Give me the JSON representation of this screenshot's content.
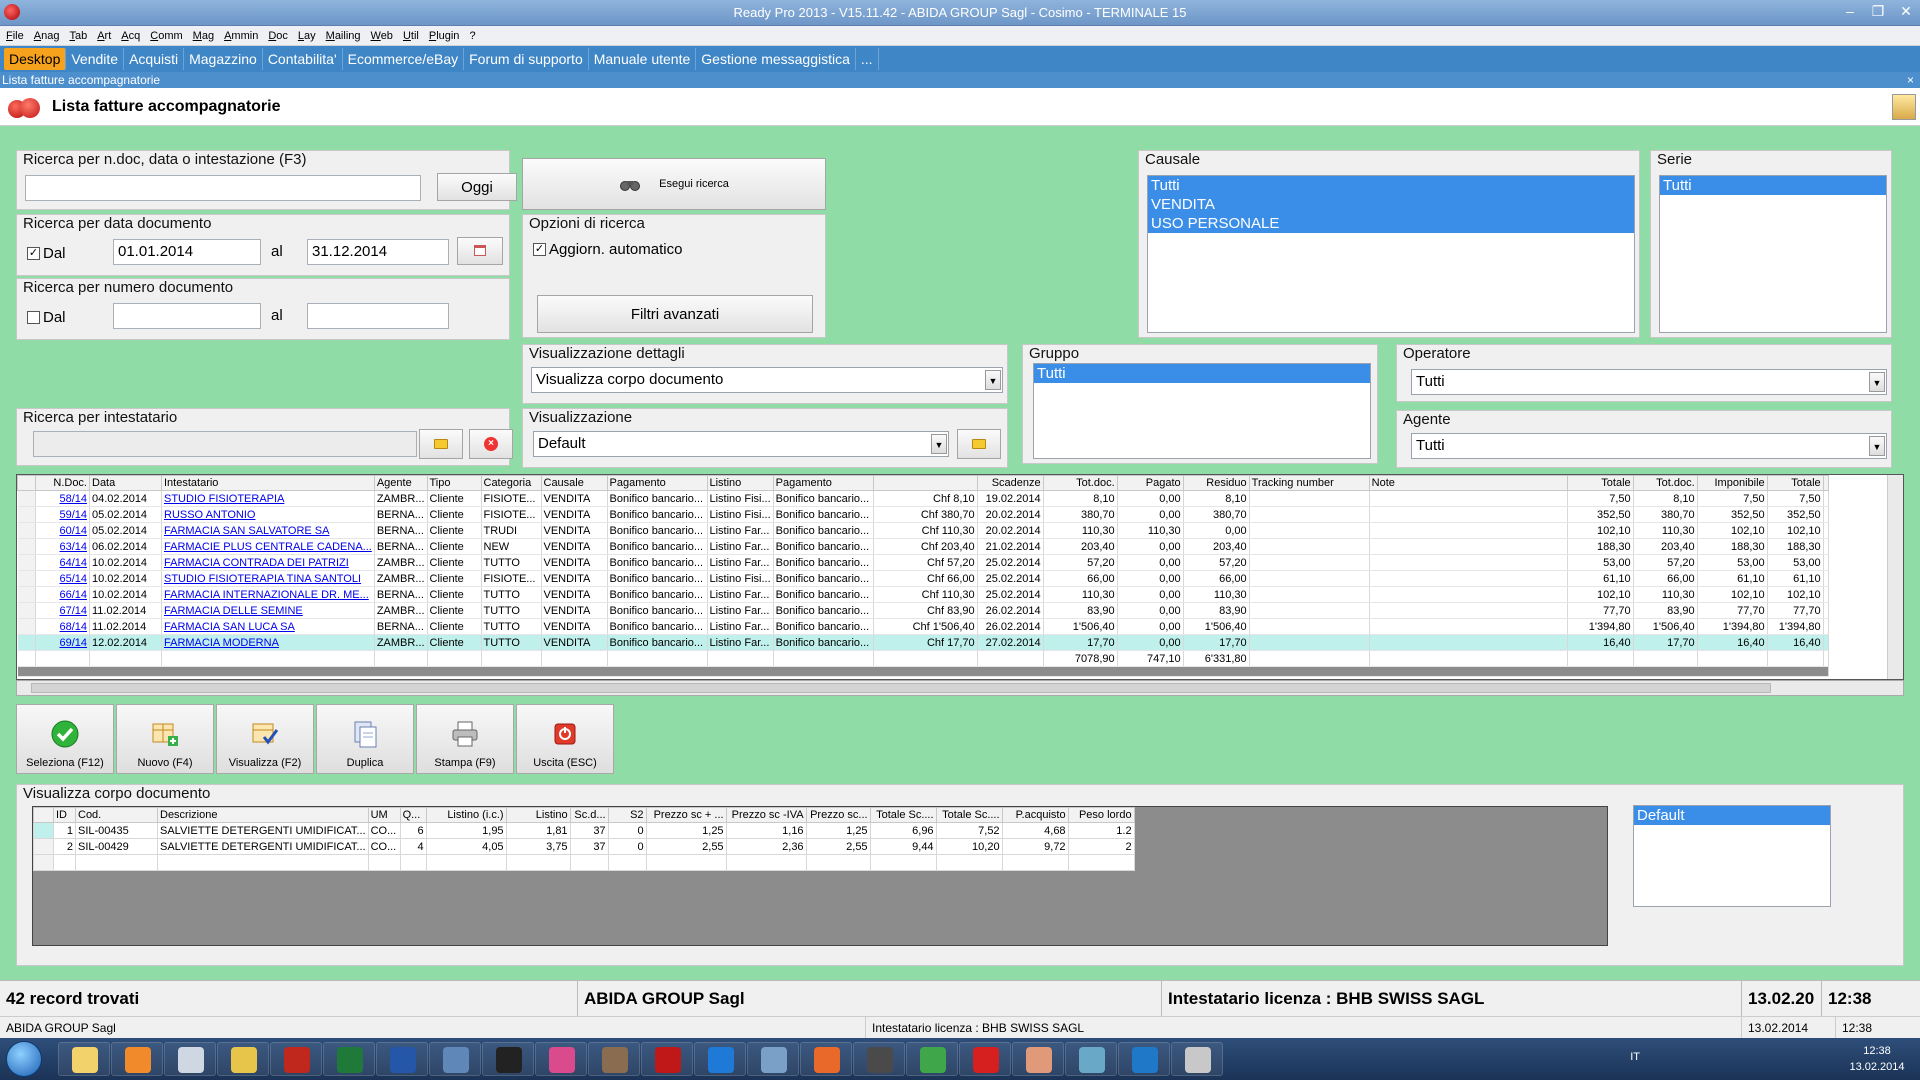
{
  "window": {
    "title": "Ready Pro 2013 - V15.11.42 - ABIDA GROUP Sagl - Cosimo - TERMINALE 15",
    "minimize": "–",
    "maximize": "❐",
    "close": "✕"
  },
  "menu": [
    "File",
    "Anag",
    "Tab",
    "Art",
    "Acq",
    "Comm",
    "Mag",
    "Ammin",
    "Doc",
    "Lay",
    "Mailing",
    "Web",
    "Util",
    "Plugin",
    "?"
  ],
  "tabs": [
    {
      "label": "Desktop",
      "active": true
    },
    {
      "label": "Vendite"
    },
    {
      "label": "Acquisti"
    },
    {
      "label": "Magazzino"
    },
    {
      "label": "Contabilita'"
    },
    {
      "label": "Ecommerce/eBay"
    },
    {
      "label": "Forum di supporto"
    },
    {
      "label": "Manuale utente"
    },
    {
      "label": "Gestione messaggistica"
    },
    {
      "label": "..."
    }
  ],
  "subwindow": {
    "title": "Lista fatture accompagnatorie",
    "close": "×"
  },
  "header": {
    "title": "Lista fatture accompagnatorie"
  },
  "search": {
    "ndoc_label": "Ricerca per n.doc, data o intestazione (F3)",
    "ndoc_value": "",
    "today_button": "Oggi",
    "execute_button": "Esegui ricerca",
    "date_label": "Ricerca per data documento",
    "date_from_check": "Dal",
    "date_from": "01.01.2014",
    "date_to_label": "al",
    "date_to": "31.12.2014",
    "num_label": "Ricerca per numero documento",
    "num_from_check": "Dal",
    "num_to_label": "al",
    "holder_label": "Ricerca per intestatario",
    "options_label": "Opzioni di ricerca",
    "auto_update": "Aggiorn. automatico",
    "advanced_filters": "Filtri avanzati",
    "details_label": "Visualizzazione dettagli",
    "details_value": "Visualizza corpo documento",
    "view_label": "Visualizzazione",
    "view_value": "Default"
  },
  "causale": {
    "label": "Causale",
    "items": [
      "Tutti",
      "VENDITA",
      "USO PERSONALE"
    ]
  },
  "serie": {
    "label": "Serie",
    "items": [
      "Tutti"
    ]
  },
  "gruppo": {
    "label": "Gruppo",
    "items": [
      "Tutti"
    ]
  },
  "operatore": {
    "label": "Operatore",
    "value": "Tutti"
  },
  "agente": {
    "label": "Agente",
    "value": "Tutti"
  },
  "grid": {
    "columns": [
      "N.Doc.",
      "Data",
      "Intestatario",
      "Agente",
      "Tipo",
      "Categoria",
      "Causale",
      "Pagamento",
      "Listino",
      "Pagamento",
      "",
      "Scadenze",
      "Tot.doc.",
      "Pagato",
      "Residuo",
      "Tracking number",
      "Note",
      "Totale",
      "Tot.doc.",
      "Imponibile",
      "Totale"
    ],
    "rows": [
      [
        "58/14",
        "04.02.2014",
        "STUDIO FISIOTERAPIA",
        "ZAMBR...",
        "Cliente",
        "FISIOTE...",
        "VENDITA",
        "Bonifico bancario...",
        "Listino Fisi...",
        "Bonifico bancario...",
        "Chf 8,10",
        "19.02.2014",
        "8,10",
        "0,00",
        "8,10",
        "",
        "",
        "7,50",
        "8,10",
        "7,50",
        "7,50"
      ],
      [
        "59/14",
        "05.02.2014",
        "RUSSO ANTONIO",
        "BERNA...",
        "Cliente",
        "FISIOTE...",
        "VENDITA",
        "Bonifico bancario...",
        "Listino Fisi...",
        "Bonifico bancario...",
        "Chf 380,70",
        "20.02.2014",
        "380,70",
        "0,00",
        "380,70",
        "",
        "",
        "352,50",
        "380,70",
        "352,50",
        "352,50"
      ],
      [
        "60/14",
        "05.02.2014",
        "FARMACIA SAN SALVATORE SA",
        "BERNA...",
        "Cliente",
        "TRUDI",
        "VENDITA",
        "Bonifico bancario...",
        "Listino Far...",
        "Bonifico bancario...",
        "Chf 110,30",
        "20.02.2014",
        "110,30",
        "110,30",
        "0,00",
        "",
        "",
        "102,10",
        "110,30",
        "102,10",
        "102,10"
      ],
      [
        "63/14",
        "06.02.2014",
        "FARMACIE PLUS CENTRALE CADENA...",
        "BERNA...",
        "Cliente",
        "NEW",
        "VENDITA",
        "Bonifico bancario...",
        "Listino Far...",
        "Bonifico bancario...",
        "Chf 203,40",
        "21.02.2014",
        "203,40",
        "0,00",
        "203,40",
        "",
        "",
        "188,30",
        "203,40",
        "188,30",
        "188,30"
      ],
      [
        "64/14",
        "10.02.2014",
        "FARMACIA CONTRADA DEI PATRIZI",
        "ZAMBR...",
        "Cliente",
        "TUTTO",
        "VENDITA",
        "Bonifico bancario...",
        "Listino Far...",
        "Bonifico bancario...",
        "Chf 57,20",
        "25.02.2014",
        "57,20",
        "0,00",
        "57,20",
        "",
        "",
        "53,00",
        "57,20",
        "53,00",
        "53,00"
      ],
      [
        "65/14",
        "10.02.2014",
        "STUDIO FISIOTERAPIA TINA SANTOLI",
        "ZAMBR...",
        "Cliente",
        "FISIOTE...",
        "VENDITA",
        "Bonifico bancario...",
        "Listino Fisi...",
        "Bonifico bancario...",
        "Chf 66,00",
        "25.02.2014",
        "66,00",
        "0,00",
        "66,00",
        "",
        "",
        "61,10",
        "66,00",
        "61,10",
        "61,10"
      ],
      [
        "66/14",
        "10.02.2014",
        "FARMACIA INTERNAZIONALE DR. ME...",
        "BERNA...",
        "Cliente",
        "TUTTO",
        "VENDITA",
        "Bonifico bancario...",
        "Listino Far...",
        "Bonifico bancario...",
        "Chf 110,30",
        "25.02.2014",
        "110,30",
        "0,00",
        "110,30",
        "",
        "",
        "102,10",
        "110,30",
        "102,10",
        "102,10"
      ],
      [
        "67/14",
        "11.02.2014",
        "FARMACIA DELLE SEMINE",
        "ZAMBR...",
        "Cliente",
        "TUTTO",
        "VENDITA",
        "Bonifico bancario...",
        "Listino Far...",
        "Bonifico bancario...",
        "Chf 83,90",
        "26.02.2014",
        "83,90",
        "0,00",
        "83,90",
        "",
        "",
        "77,70",
        "83,90",
        "77,70",
        "77,70"
      ],
      [
        "68/14",
        "11.02.2014",
        "FARMACIA SAN LUCA SA",
        "BERNA...",
        "Cliente",
        "TUTTO",
        "VENDITA",
        "Bonifico bancario...",
        "Listino Far...",
        "Bonifico bancario...",
        "Chf 1'506,40",
        "26.02.2014",
        "1'506,40",
        "0,00",
        "1'506,40",
        "",
        "",
        "1'394,80",
        "1'506,40",
        "1'394,80",
        "1'394,80"
      ],
      [
        "69/14",
        "12.02.2014",
        "FARMACIA MODERNA",
        "ZAMBR...",
        "Cliente",
        "TUTTO",
        "VENDITA",
        "Bonifico bancario...",
        "Listino Far...",
        "Bonifico bancario...",
        "Chf 17,70",
        "27.02.2014",
        "17,70",
        "0,00",
        "17,70",
        "",
        "",
        "16,40",
        "17,70",
        "16,40",
        "16,40"
      ]
    ],
    "totals": {
      "totdoc": "7078,90",
      "pagato": "747,10",
      "residuo": "6'331,80"
    }
  },
  "toolbar": [
    {
      "label": "Seleziona (F12)",
      "icon": "check-icon"
    },
    {
      "label": "Nuovo (F4)",
      "icon": "new-doc-icon"
    },
    {
      "label": "Visualizza (F2)",
      "icon": "view-icon"
    },
    {
      "label": "Duplica",
      "icon": "duplicate-icon"
    },
    {
      "label": "Stampa (F9)",
      "icon": "printer-icon"
    },
    {
      "label": "Uscita (ESC)",
      "icon": "exit-icon"
    }
  ],
  "detail": {
    "label": "Visualizza corpo documento",
    "columns": [
      "ID",
      "Cod.",
      "Descrizione",
      "UM",
      "Q...",
      "Listino (i.c.)",
      "Listino",
      "Sc.d...",
      "S2",
      "Prezzo sc + ...",
      "Prezzo sc -IVA",
      "Prezzo sc...",
      "Totale Sc....",
      "Totale Sc....",
      "P.acquisto",
      "Peso lordo"
    ],
    "rows": [
      [
        "1",
        "SIL-00435",
        "SALVIETTE DETERGENTI UMIDIFICAT...",
        "CO...",
        "6",
        "1,95",
        "1,81",
        "37",
        "0",
        "1,25",
        "1,16",
        "1,25",
        "6,96",
        "7,52",
        "4,68",
        "1.2"
      ],
      [
        "2",
        "SIL-00429",
        "SALVIETTE DETERGENTI UMIDIFICAT...",
        "CO...",
        "4",
        "4,05",
        "3,75",
        "37",
        "0",
        "2,55",
        "2,36",
        "2,55",
        "9,44",
        "10,20",
        "9,72",
        "2"
      ]
    ],
    "layout_items": [
      "Default"
    ]
  },
  "status": {
    "records": "42 record trovati",
    "company": "ABIDA GROUP Sagl",
    "license": "Intestatario licenza : BHB SWISS SAGL",
    "date": "13.02.20",
    "time": "12:38"
  },
  "status2": {
    "company": "ABIDA GROUP Sagl",
    "license": "Intestatario licenza : BHB SWISS SAGL",
    "date": "13.02.2014",
    "time": "12:38"
  },
  "taskbar": {
    "lang": "IT",
    "clock_time": "12:38",
    "clock_date": "13.02.2014",
    "apps": [
      {
        "name": "explorer-icon",
        "color": "#f2d26a"
      },
      {
        "name": "media-player-icon",
        "color": "#f08a2a"
      },
      {
        "name": "network-icon",
        "color": "#cfd8e2"
      },
      {
        "name": "folder-sync-icon",
        "color": "#e7c44a"
      },
      {
        "name": "filezilla-icon",
        "color": "#c0281e"
      },
      {
        "name": "excel-icon",
        "color": "#1f7a3a"
      },
      {
        "name": "word-icon",
        "color": "#2457a8"
      },
      {
        "name": "remote-icon",
        "color": "#5f88b8"
      },
      {
        "name": "pm-icon",
        "color": "#222222"
      },
      {
        "name": "picasa-icon",
        "color": "#d94b8c"
      },
      {
        "name": "gimp-icon",
        "color": "#8a6d50"
      },
      {
        "name": "acrobat-icon",
        "color": "#c01818"
      },
      {
        "name": "teamviewer-icon",
        "color": "#1e7ad6"
      },
      {
        "name": "control-panel-icon",
        "color": "#7aa0c8"
      },
      {
        "name": "firefox-icon",
        "color": "#e8692a"
      },
      {
        "name": "terminal-icon",
        "color": "#4a4a4a"
      },
      {
        "name": "chrome-icon",
        "color": "#3fa64a"
      },
      {
        "name": "readypro-icon",
        "color": "#d61f1f"
      },
      {
        "name": "mail-icon",
        "color": "#e09a7a"
      },
      {
        "name": "notepad-icon",
        "color": "#6aa8c8"
      },
      {
        "name": "skype-icon",
        "color": "#1f78c8"
      },
      {
        "name": "paint-icon",
        "color": "#c8c8c8"
      }
    ]
  }
}
